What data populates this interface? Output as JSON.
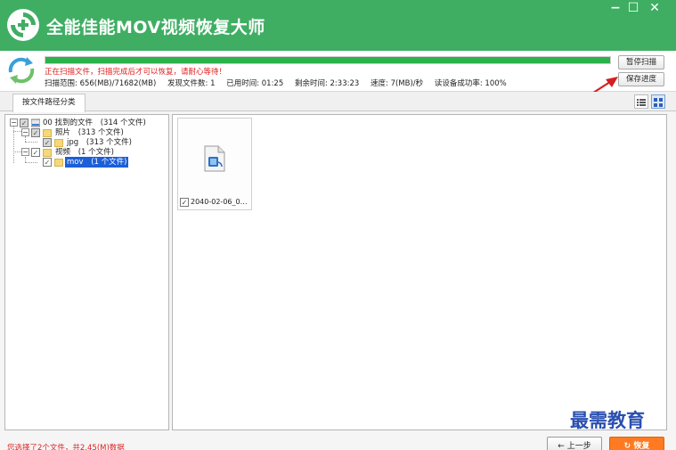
{
  "app": {
    "title": "全能佳能MOV视频恢复大师",
    "brand_color": "#3fae63",
    "window_controls": {
      "minimize": "−",
      "maximize": "☐",
      "close": "✕"
    }
  },
  "scan": {
    "progress": 1.0,
    "message": "正在扫描文件，扫描完成后才可以恢复，请耐心等待！",
    "range": "扫描范围: 656(MB)/71682(MB)",
    "found": "发现文件数: 1",
    "elapsed": "已用时间: 01:25",
    "remaining": "剩余时间: 2:33:23",
    "speed": "速度: 7(MB)/秒",
    "read_rate": "读设备成功率: 100%",
    "pause_label": "暂停扫描",
    "save_label": "保存进度"
  },
  "tabs": {
    "by_path": "按文件路径分类"
  },
  "tree": {
    "root": {
      "label": "00 找到的文件",
      "count": "(314 个文件)"
    },
    "photos": {
      "label": "照片",
      "count": "(313 个文件)"
    },
    "jpg": {
      "label": "jpg",
      "count": "(313 个文件)"
    },
    "video": {
      "label": "视频",
      "count": "(1 个文件)"
    },
    "mov": {
      "label": "mov",
      "count": "(1 个文件)"
    }
  },
  "files": [
    {
      "name": "2040-02-06_0628...",
      "checked": "✓",
      "icon": "video-file-icon"
    }
  ],
  "footer": {
    "status": "您选择了2个文件，共2.45(M)数据",
    "prev_label": "← 上一步",
    "recover_label": "↻ 恢复"
  },
  "watermark": "最需教育"
}
